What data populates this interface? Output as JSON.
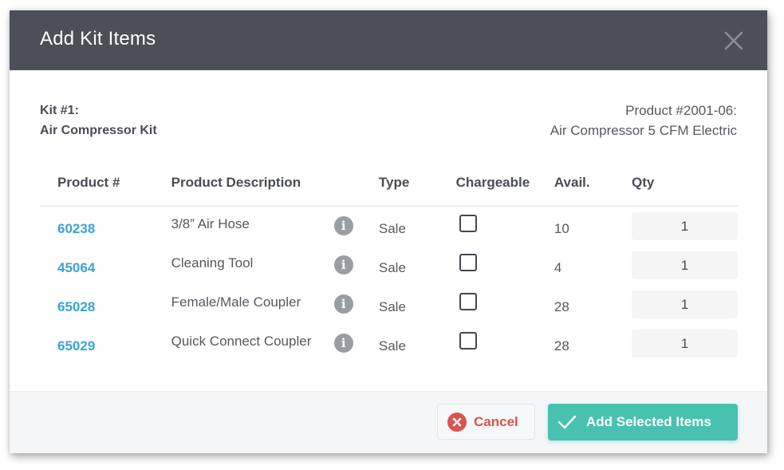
{
  "dialog": {
    "title": "Add Kit Items",
    "close_icon": "close-icon"
  },
  "kit": {
    "label": "Kit #1:",
    "name": "Air Compressor Kit"
  },
  "product": {
    "label": "Product #2001-06:",
    "name": "Air Compressor 5 CFM Electric"
  },
  "table": {
    "headers": {
      "product_num": "Product #",
      "description": "Product Description",
      "type": "Type",
      "chargeable": "Chargeable",
      "avail": "Avail.",
      "qty": "Qty"
    },
    "rows": [
      {
        "product_num": "60238",
        "description": "3/8” Air Hose",
        "type": "Sale",
        "chargeable": false,
        "avail": "10",
        "qty": "1"
      },
      {
        "product_num": "45064",
        "description": "Cleaning Tool",
        "type": "Sale",
        "chargeable": false,
        "avail": "4",
        "qty": "1"
      },
      {
        "product_num": "65028",
        "description": "Female/Male Coupler",
        "type": "Sale",
        "chargeable": false,
        "avail": "28",
        "qty": "1"
      },
      {
        "product_num": "65029",
        "description": "Quick Connect Coupler",
        "type": "Sale",
        "chargeable": false,
        "avail": "28",
        "qty": "1"
      }
    ]
  },
  "footer": {
    "cancel_label": "Cancel",
    "add_label": "Add Selected Items"
  },
  "colors": {
    "header_bg": "#4b4f57",
    "link": "#3aa3d4",
    "cancel": "#d9534f",
    "primary": "#48c1b0"
  }
}
